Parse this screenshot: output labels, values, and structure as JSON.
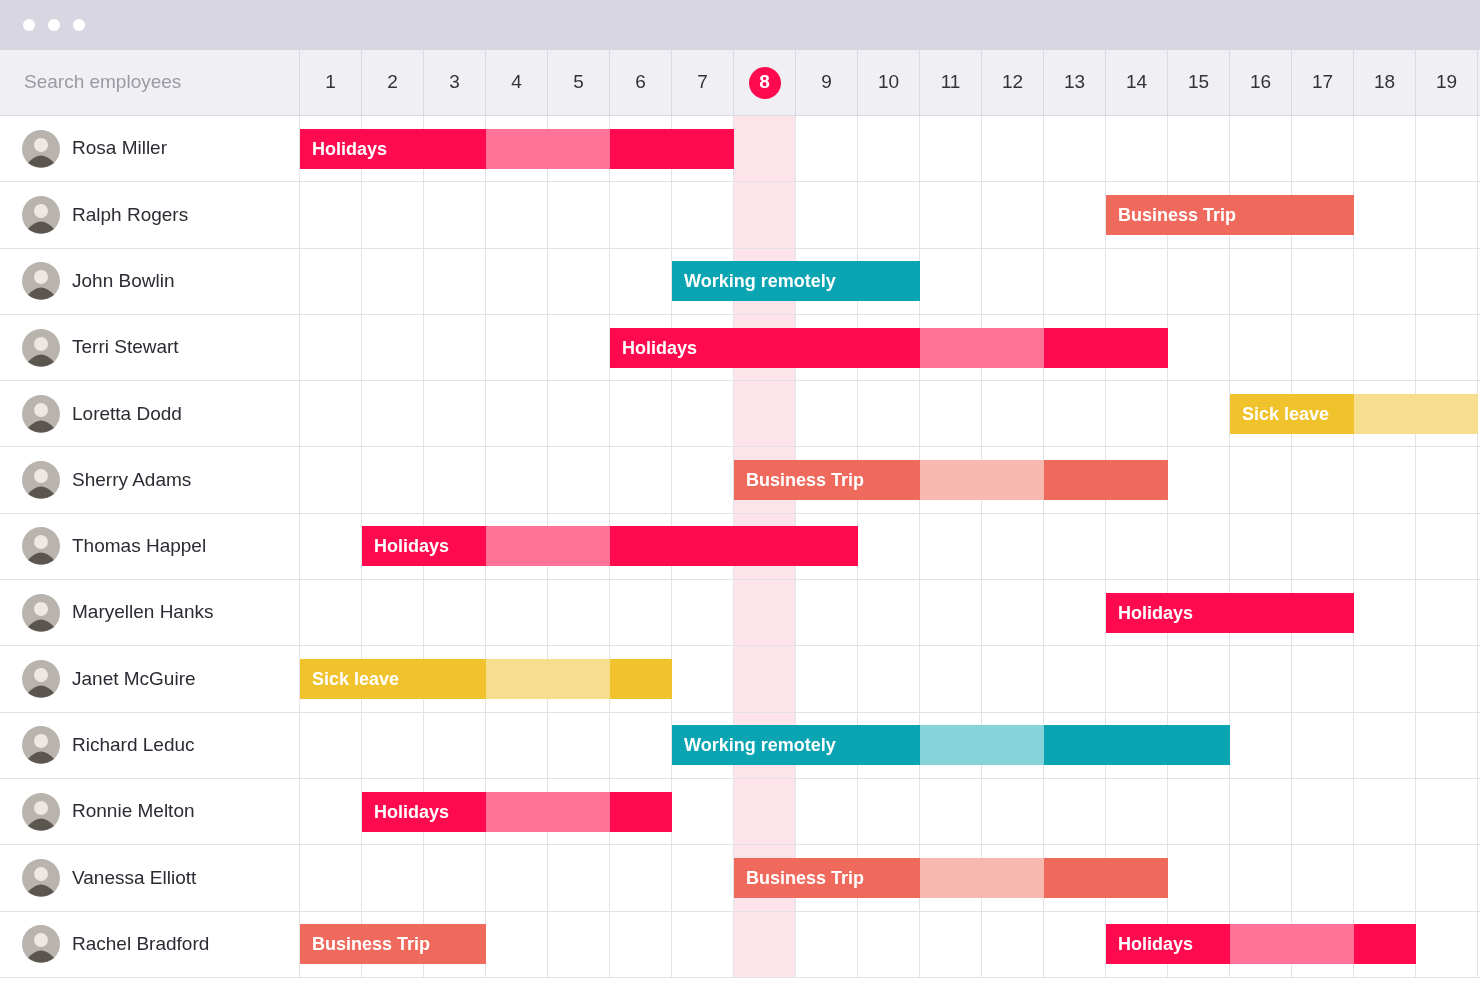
{
  "search": {
    "placeholder": "Search employees"
  },
  "days": [
    {
      "label": "1",
      "selected": false
    },
    {
      "label": "2",
      "selected": false
    },
    {
      "label": "3",
      "selected": false
    },
    {
      "label": "4",
      "selected": false
    },
    {
      "label": "5",
      "selected": false
    },
    {
      "label": "6",
      "selected": false
    },
    {
      "label": "7",
      "selected": false
    },
    {
      "label": "8",
      "selected": true
    },
    {
      "label": "9",
      "selected": false
    },
    {
      "label": "10",
      "selected": false
    },
    {
      "label": "11",
      "selected": false
    },
    {
      "label": "12",
      "selected": false
    },
    {
      "label": "13",
      "selected": false
    },
    {
      "label": "14",
      "selected": false
    },
    {
      "label": "15",
      "selected": false
    },
    {
      "label": "16",
      "selected": false
    },
    {
      "label": "17",
      "selected": false
    },
    {
      "label": "18",
      "selected": false
    },
    {
      "label": "19",
      "selected": false
    }
  ],
  "employees": [
    {
      "name": "Rosa Miller",
      "timeline": [
        {
          "kind": "holidays",
          "label": "Holidays",
          "days": [
            {
              "light": false
            },
            {
              "light": false
            },
            {
              "light": false
            },
            {
              "light": true
            },
            {
              "light": true
            },
            {
              "light": false
            },
            {
              "light": false
            }
          ]
        }
      ]
    },
    {
      "name": "Ralph Rogers",
      "timeline": [
        {
          "kind": "gap"
        },
        {
          "kind": "gap"
        },
        {
          "kind": "gap"
        },
        {
          "kind": "gap"
        },
        {
          "kind": "gap"
        },
        {
          "kind": "gap"
        },
        {
          "kind": "gap"
        },
        {
          "kind": "gap"
        },
        {
          "kind": "gap"
        },
        {
          "kind": "gap"
        },
        {
          "kind": "gap"
        },
        {
          "kind": "gap"
        },
        {
          "kind": "gap"
        },
        {
          "kind": "business_trip",
          "label": "Business Trip",
          "days": [
            {
              "light": false
            },
            {
              "light": false
            },
            {
              "light": false
            },
            {
              "light": false
            }
          ]
        }
      ]
    },
    {
      "name": "John Bowlin",
      "timeline": [
        {
          "kind": "gap"
        },
        {
          "kind": "gap"
        },
        {
          "kind": "gap"
        },
        {
          "kind": "gap"
        },
        {
          "kind": "gap"
        },
        {
          "kind": "gap"
        },
        {
          "kind": "remote",
          "label": "Working remotely",
          "days": [
            {
              "light": false
            },
            {
              "light": false
            },
            {
              "light": false
            },
            {
              "light": false
            }
          ]
        }
      ]
    },
    {
      "name": "Terri Stewart",
      "timeline": [
        {
          "kind": "gap"
        },
        {
          "kind": "gap"
        },
        {
          "kind": "gap"
        },
        {
          "kind": "gap"
        },
        {
          "kind": "gap"
        },
        {
          "kind": "holidays",
          "label": "Holidays",
          "days": [
            {
              "light": false
            },
            {
              "light": false
            },
            {
              "light": false
            },
            {
              "light": false
            },
            {
              "light": false
            },
            {
              "light": true
            },
            {
              "light": true
            },
            {
              "light": false
            },
            {
              "light": false
            }
          ]
        }
      ]
    },
    {
      "name": "Loretta Dodd",
      "timeline": [
        {
          "kind": "gap"
        },
        {
          "kind": "gap"
        },
        {
          "kind": "gap"
        },
        {
          "kind": "gap"
        },
        {
          "kind": "gap"
        },
        {
          "kind": "gap"
        },
        {
          "kind": "gap"
        },
        {
          "kind": "gap"
        },
        {
          "kind": "gap"
        },
        {
          "kind": "gap"
        },
        {
          "kind": "gap"
        },
        {
          "kind": "gap"
        },
        {
          "kind": "gap"
        },
        {
          "kind": "gap"
        },
        {
          "kind": "gap"
        },
        {
          "kind": "sick_leave",
          "label": "Sick leave",
          "days": [
            {
              "light": false
            },
            {
              "light": false
            },
            {
              "light": true
            },
            {
              "light": true
            }
          ]
        }
      ]
    },
    {
      "name": "Sherry Adams",
      "timeline": [
        {
          "kind": "gap"
        },
        {
          "kind": "gap"
        },
        {
          "kind": "gap"
        },
        {
          "kind": "gap"
        },
        {
          "kind": "gap"
        },
        {
          "kind": "gap"
        },
        {
          "kind": "gap"
        },
        {
          "kind": "business_trip",
          "label": "Business Trip",
          "days": [
            {
              "light": false
            },
            {
              "light": false
            },
            {
              "light": false
            },
            {
              "light": true
            },
            {
              "light": true
            },
            {
              "light": false
            },
            {
              "light": false
            }
          ]
        }
      ]
    },
    {
      "name": "Thomas Happel",
      "timeline": [
        {
          "kind": "gap"
        },
        {
          "kind": "holidays",
          "label": "Holidays",
          "days": [
            {
              "light": false
            },
            {
              "light": false
            },
            {
              "light": true
            },
            {
              "light": true
            },
            {
              "light": false
            },
            {
              "light": false
            },
            {
              "light": false
            },
            {
              "light": false
            }
          ]
        }
      ]
    },
    {
      "name": "Maryellen Hanks",
      "timeline": [
        {
          "kind": "gap"
        },
        {
          "kind": "gap"
        },
        {
          "kind": "gap"
        },
        {
          "kind": "gap"
        },
        {
          "kind": "gap"
        },
        {
          "kind": "gap"
        },
        {
          "kind": "gap"
        },
        {
          "kind": "gap"
        },
        {
          "kind": "gap"
        },
        {
          "kind": "gap"
        },
        {
          "kind": "gap"
        },
        {
          "kind": "gap"
        },
        {
          "kind": "gap"
        },
        {
          "kind": "holidays",
          "label": "Holidays",
          "days": [
            {
              "light": false
            },
            {
              "light": false
            },
            {
              "light": false
            },
            {
              "light": false
            }
          ]
        }
      ]
    },
    {
      "name": "Janet McGuire",
      "timeline": [
        {
          "kind": "sick_leave",
          "label": "Sick leave",
          "days": [
            {
              "light": false
            },
            {
              "light": false
            },
            {
              "light": false
            },
            {
              "light": true
            },
            {
              "light": true
            },
            {
              "light": false
            }
          ]
        }
      ]
    },
    {
      "name": "Richard Leduc",
      "timeline": [
        {
          "kind": "gap"
        },
        {
          "kind": "gap"
        },
        {
          "kind": "gap"
        },
        {
          "kind": "gap"
        },
        {
          "kind": "gap"
        },
        {
          "kind": "gap"
        },
        {
          "kind": "remote",
          "label": "Working remotely",
          "days": [
            {
              "light": false
            },
            {
              "light": false
            },
            {
              "light": false
            },
            {
              "light": false
            },
            {
              "light": true
            },
            {
              "light": true
            },
            {
              "light": false
            },
            {
              "light": false
            },
            {
              "light": false
            }
          ]
        }
      ]
    },
    {
      "name": "Ronnie Melton",
      "timeline": [
        {
          "kind": "gap"
        },
        {
          "kind": "holidays",
          "label": "Holidays",
          "days": [
            {
              "light": false
            },
            {
              "light": false
            },
            {
              "light": true
            },
            {
              "light": true
            },
            {
              "light": false
            }
          ]
        }
      ]
    },
    {
      "name": "Vanessa Elliott",
      "timeline": [
        {
          "kind": "gap"
        },
        {
          "kind": "gap"
        },
        {
          "kind": "gap"
        },
        {
          "kind": "gap"
        },
        {
          "kind": "gap"
        },
        {
          "kind": "gap"
        },
        {
          "kind": "gap"
        },
        {
          "kind": "business_trip",
          "label": "Business Trip",
          "days": [
            {
              "light": false
            },
            {
              "light": false
            },
            {
              "light": false
            },
            {
              "light": true
            },
            {
              "light": true
            },
            {
              "light": false
            },
            {
              "light": false
            }
          ]
        }
      ]
    },
    {
      "name": "Rachel Bradford",
      "timeline": [
        {
          "kind": "business_trip",
          "label": "Business Trip",
          "days": [
            {
              "light": false
            },
            {
              "light": false
            },
            {
              "light": false
            }
          ]
        },
        {
          "kind": "gap"
        },
        {
          "kind": "gap"
        },
        {
          "kind": "gap"
        },
        {
          "kind": "gap"
        },
        {
          "kind": "gap"
        },
        {
          "kind": "gap"
        },
        {
          "kind": "gap"
        },
        {
          "kind": "gap"
        },
        {
          "kind": "gap"
        },
        {
          "kind": "gap"
        },
        {
          "kind": "holidays",
          "label": "Holidays",
          "days": [
            {
              "light": false
            },
            {
              "light": false
            },
            {
              "light": true
            },
            {
              "light": true
            },
            {
              "light": false
            }
          ]
        }
      ]
    }
  ]
}
